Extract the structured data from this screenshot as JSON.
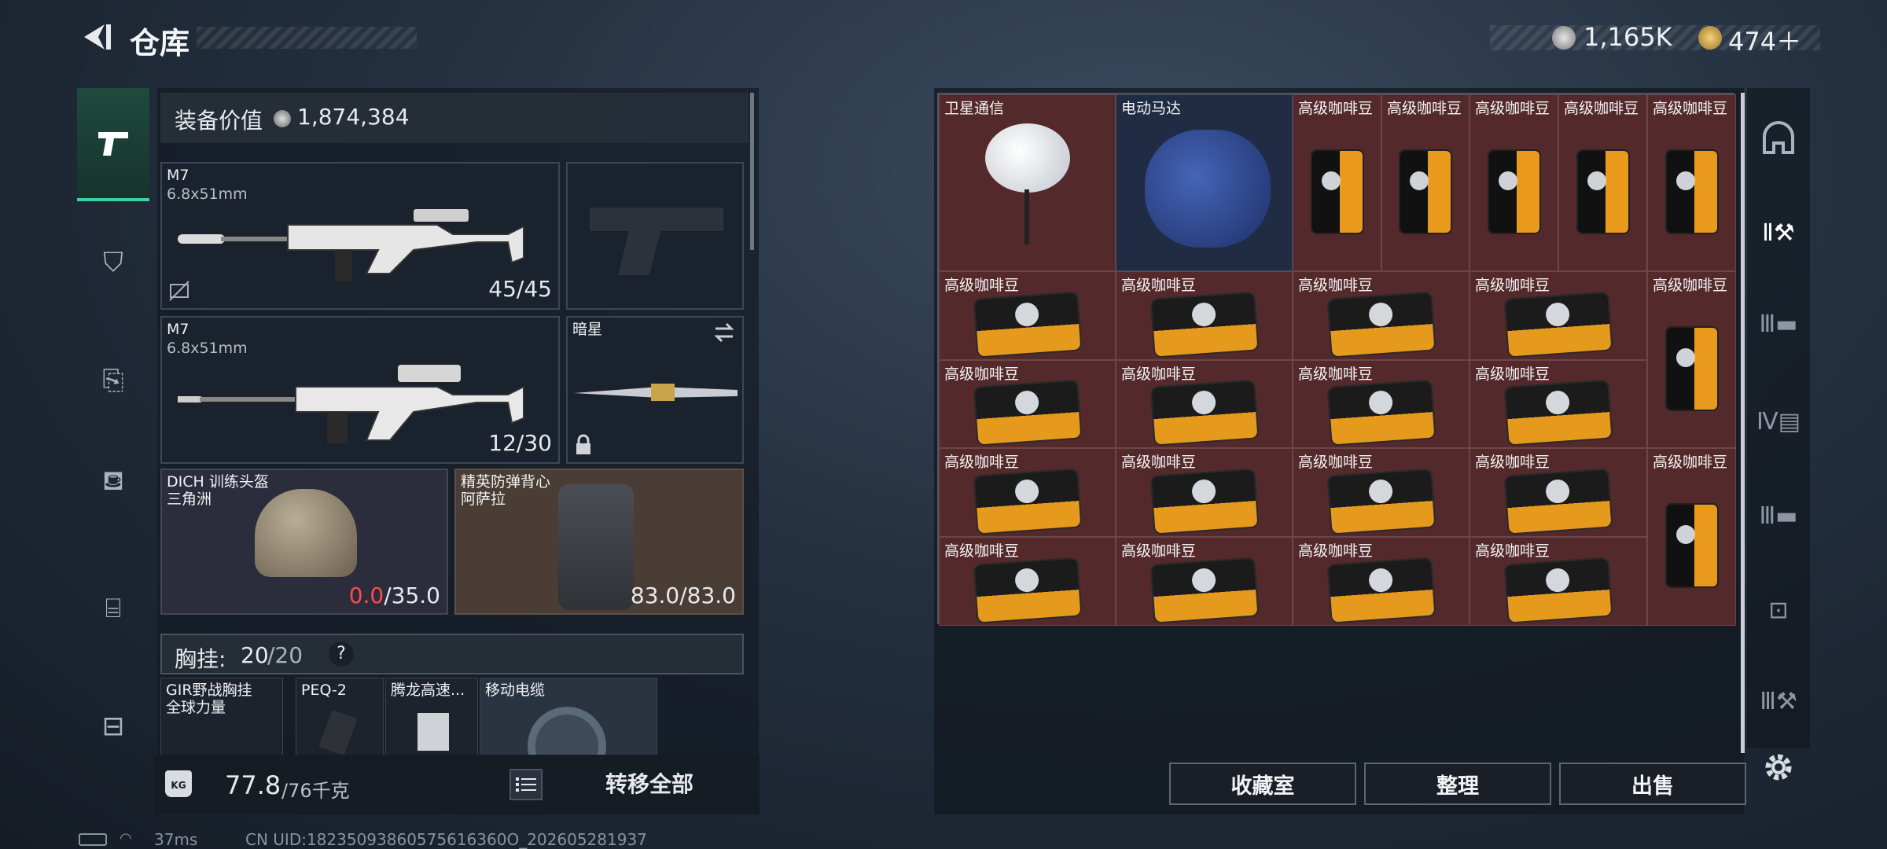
{
  "header": {
    "back_icon": "back-arrow-icon",
    "title": "仓库",
    "currency1_icon": "coin-icon",
    "currency1": "1,165K",
    "currency2_icon": "gem-icon",
    "currency2": "474＋"
  },
  "left_tabs": [
    {
      "icon": "pistol-icon"
    },
    {
      "icon": "vest-icon"
    },
    {
      "icon": "backpack-icon"
    },
    {
      "icon": "pouch-icon"
    },
    {
      "icon": "case-icon"
    },
    {
      "icon": "toolbox-icon"
    }
  ],
  "equipment": {
    "value_label": "装备价值",
    "value": "1,874,384",
    "primary1": {
      "name": "M7",
      "caliber": "6.8x51mm",
      "ammo": "45/45"
    },
    "primary2": {
      "name": "M7",
      "caliber": "6.8x51mm",
      "ammo": "12/30"
    },
    "melee": {
      "name": "暗星"
    },
    "helmet": {
      "name": "DICH 训练头盔",
      "origin": "三角洲",
      "durability_current": "0.0",
      "durability_max": "/35.0"
    },
    "armor": {
      "name": "精英防弹背心",
      "origin": "阿萨拉",
      "durability": "83.0/83.0"
    },
    "chest_rig_label": "胸挂:",
    "chest_rig_current": "20",
    "chest_rig_max": "/20",
    "help": "?",
    "rig_items": [
      {
        "name": "GIR野战胸挂",
        "sub": "全球力量"
      },
      {
        "name": "PEQ-2"
      },
      {
        "name": "腾龙高速..."
      },
      {
        "name": "移动电缆"
      }
    ],
    "weight_current": "77.8",
    "weight_max": "/76千克",
    "weight_icon": "KG",
    "transfer_all": "转移全部"
  },
  "storage": {
    "top_items": [
      "卫星通信",
      "电动马达",
      "高级咖啡豆",
      "高级咖啡豆",
      "高级咖啡豆",
      "高级咖啡豆",
      "高级咖啡豆"
    ],
    "coffee_label": "高级咖啡豆"
  },
  "buttons": {
    "collection": "收藏室",
    "organize": "整理",
    "sell": "出售"
  },
  "status": {
    "ping": "37ms",
    "uid": "CN UID:18235093860575616360O_202605281937"
  }
}
